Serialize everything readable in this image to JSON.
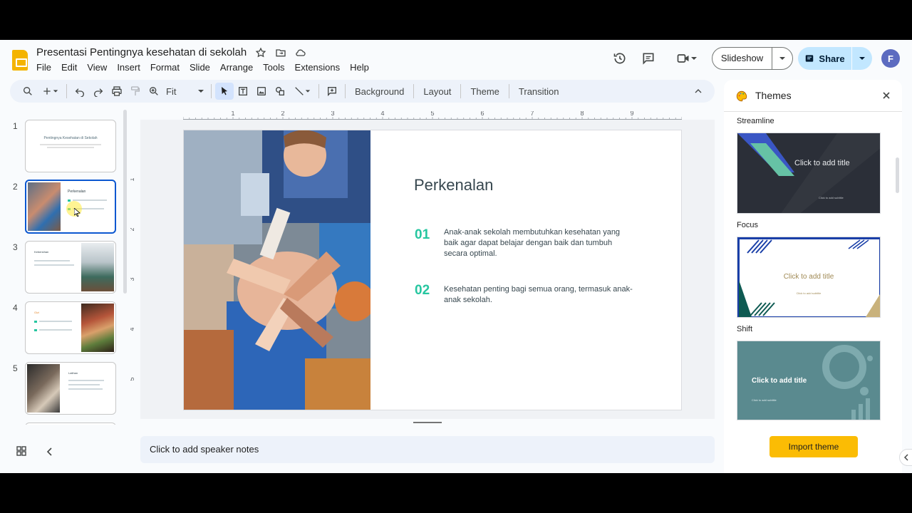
{
  "header": {
    "doc_title": "Presentasi Pentingnya kesehatan di sekolah",
    "menu": [
      "File",
      "Edit",
      "View",
      "Insert",
      "Format",
      "Slide",
      "Arrange",
      "Tools",
      "Extensions",
      "Help"
    ],
    "slideshow_label": "Slideshow",
    "share_label": "Share",
    "avatar_initial": "F"
  },
  "toolbar": {
    "zoom_label": "Fit",
    "background_label": "Background",
    "layout_label": "Layout",
    "theme_label": "Theme",
    "transition_label": "Transition"
  },
  "ruler": {
    "top_ticks": [
      "1",
      "2",
      "3",
      "4",
      "5",
      "6",
      "7",
      "8",
      "9"
    ],
    "left_ticks": [
      "1",
      "2",
      "3",
      "4",
      "5"
    ]
  },
  "filmstrip": {
    "slides": [
      {
        "number": "1",
        "title": "Pentingnya Kesehatan di Sekolah"
      },
      {
        "number": "2",
        "title": "Perkenalan"
      },
      {
        "number": "3",
        "title": "Kebersihan"
      },
      {
        "number": "4",
        "title": "Gizi"
      },
      {
        "number": "5",
        "title": "Latihan"
      },
      {
        "number": "6",
        "title": ""
      }
    ],
    "selected_index": 1
  },
  "slide": {
    "title": "Perkenalan",
    "items": [
      {
        "number": "01",
        "text": "Anak-anak sekolah membutuhkan kesehatan yang baik agar dapat belajar dengan baik dan tumbuh secara optimal."
      },
      {
        "number": "02",
        "text": "Kesehatan penting bagi semua orang, termasuk anak-anak sekolah."
      }
    ]
  },
  "notes": {
    "placeholder": "Click to add speaker notes"
  },
  "themes_panel": {
    "title": "Themes",
    "themes": [
      {
        "name": "Streamline",
        "card_title": "Click to add title",
        "card_subtitle": "Click to add subtitle"
      },
      {
        "name": "Focus",
        "card_title": "Click to add title",
        "card_subtitle": "Click to add subtitle"
      },
      {
        "name": "Shift",
        "card_title": "Click to add title",
        "card_subtitle": "Click to add subtitle"
      }
    ],
    "import_label": "Import theme"
  },
  "colors": {
    "accent": "#0b57d0",
    "share_bg": "#c2e7ff",
    "slide_number": "#26c6a0",
    "import_button": "#fbbc04"
  }
}
